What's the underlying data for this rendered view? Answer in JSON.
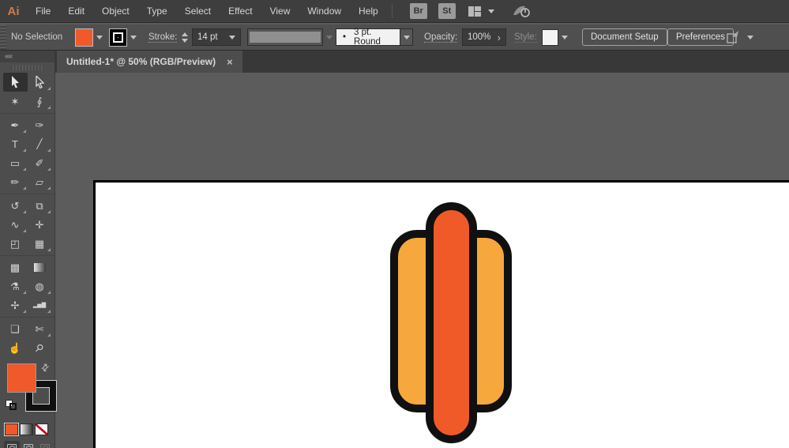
{
  "app": {
    "logo_text": "Ai"
  },
  "menu_bar": {
    "items": [
      "File",
      "Edit",
      "Object",
      "Type",
      "Select",
      "Effect",
      "View",
      "Window",
      "Help"
    ],
    "bridge_button": "Br",
    "stock_button": "St"
  },
  "control_bar": {
    "selection_status": "No Selection",
    "stroke_label": "Stroke:",
    "stroke_weight_value": "14 pt",
    "brush_dot": "•",
    "brush_definition": "3 pt. Round",
    "opacity_label": "Opacity:",
    "opacity_value": "100%",
    "opacity_submenu_arrow": "›",
    "style_label": "Style:",
    "document_setup_button": "Document Setup",
    "preferences_button": "Preferences"
  },
  "document_tab": {
    "title": "Untitled-1* @ 50% (RGB/Preview)",
    "close_glyph": "×",
    "zoom_level": "50%",
    "color_mode": "RGB/Preview"
  },
  "tool_panel": {
    "collapse_glyph": "««",
    "swap_glyph": "⇄",
    "tools": [
      {
        "name": "selection-tool",
        "glyph": "",
        "selected": true
      },
      {
        "name": "direct-selection-tool",
        "glyph": ""
      },
      {
        "name": "magic-wand-tool",
        "glyph": "✶"
      },
      {
        "name": "lasso-tool",
        "glyph": "∮"
      },
      {
        "name": "pen-tool",
        "glyph": "✒"
      },
      {
        "name": "curvature-tool",
        "glyph": "✑"
      },
      {
        "name": "type-tool",
        "glyph": "T"
      },
      {
        "name": "line-segment-tool",
        "glyph": "╱"
      },
      {
        "name": "rectangle-tool",
        "glyph": "▭"
      },
      {
        "name": "paintbrush-tool",
        "glyph": "✐"
      },
      {
        "name": "shaper-tool",
        "glyph": "✏"
      },
      {
        "name": "eraser-tool",
        "glyph": "▱"
      },
      {
        "name": "rotate-tool",
        "glyph": "↺"
      },
      {
        "name": "scale-tool",
        "glyph": "⧉"
      },
      {
        "name": "width-tool",
        "glyph": "∿"
      },
      {
        "name": "puppet-warp-tool",
        "glyph": "✛"
      },
      {
        "name": "shape-builder-tool",
        "glyph": "◰"
      },
      {
        "name": "perspective-grid-tool",
        "glyph": "▦"
      },
      {
        "name": "mesh-tool",
        "glyph": "▩"
      },
      {
        "name": "gradient-tool",
        "glyph": ""
      },
      {
        "name": "eyedropper-tool",
        "glyph": "⚗"
      },
      {
        "name": "blend-tool",
        "glyph": "◍"
      },
      {
        "name": "symbol-sprayer-tool",
        "glyph": "✢"
      },
      {
        "name": "column-graph-tool",
        "glyph": "▂▅▇"
      },
      {
        "name": "artboard-tool",
        "glyph": "❏"
      },
      {
        "name": "slice-tool",
        "glyph": "✄"
      },
      {
        "name": "hand-tool",
        "glyph": "☝"
      },
      {
        "name": "zoom-tool",
        "glyph": "⚲"
      }
    ]
  },
  "colors": {
    "fill_swatch": "#F0592B",
    "bun_fill": "#F6A83C",
    "sausage_fill": "#EF5A28",
    "artwork_outline": "#101010",
    "none_stripe_red": "#D0021B",
    "ui_background": "#4F4F4F",
    "pasteboard": "#5C5C5C"
  }
}
